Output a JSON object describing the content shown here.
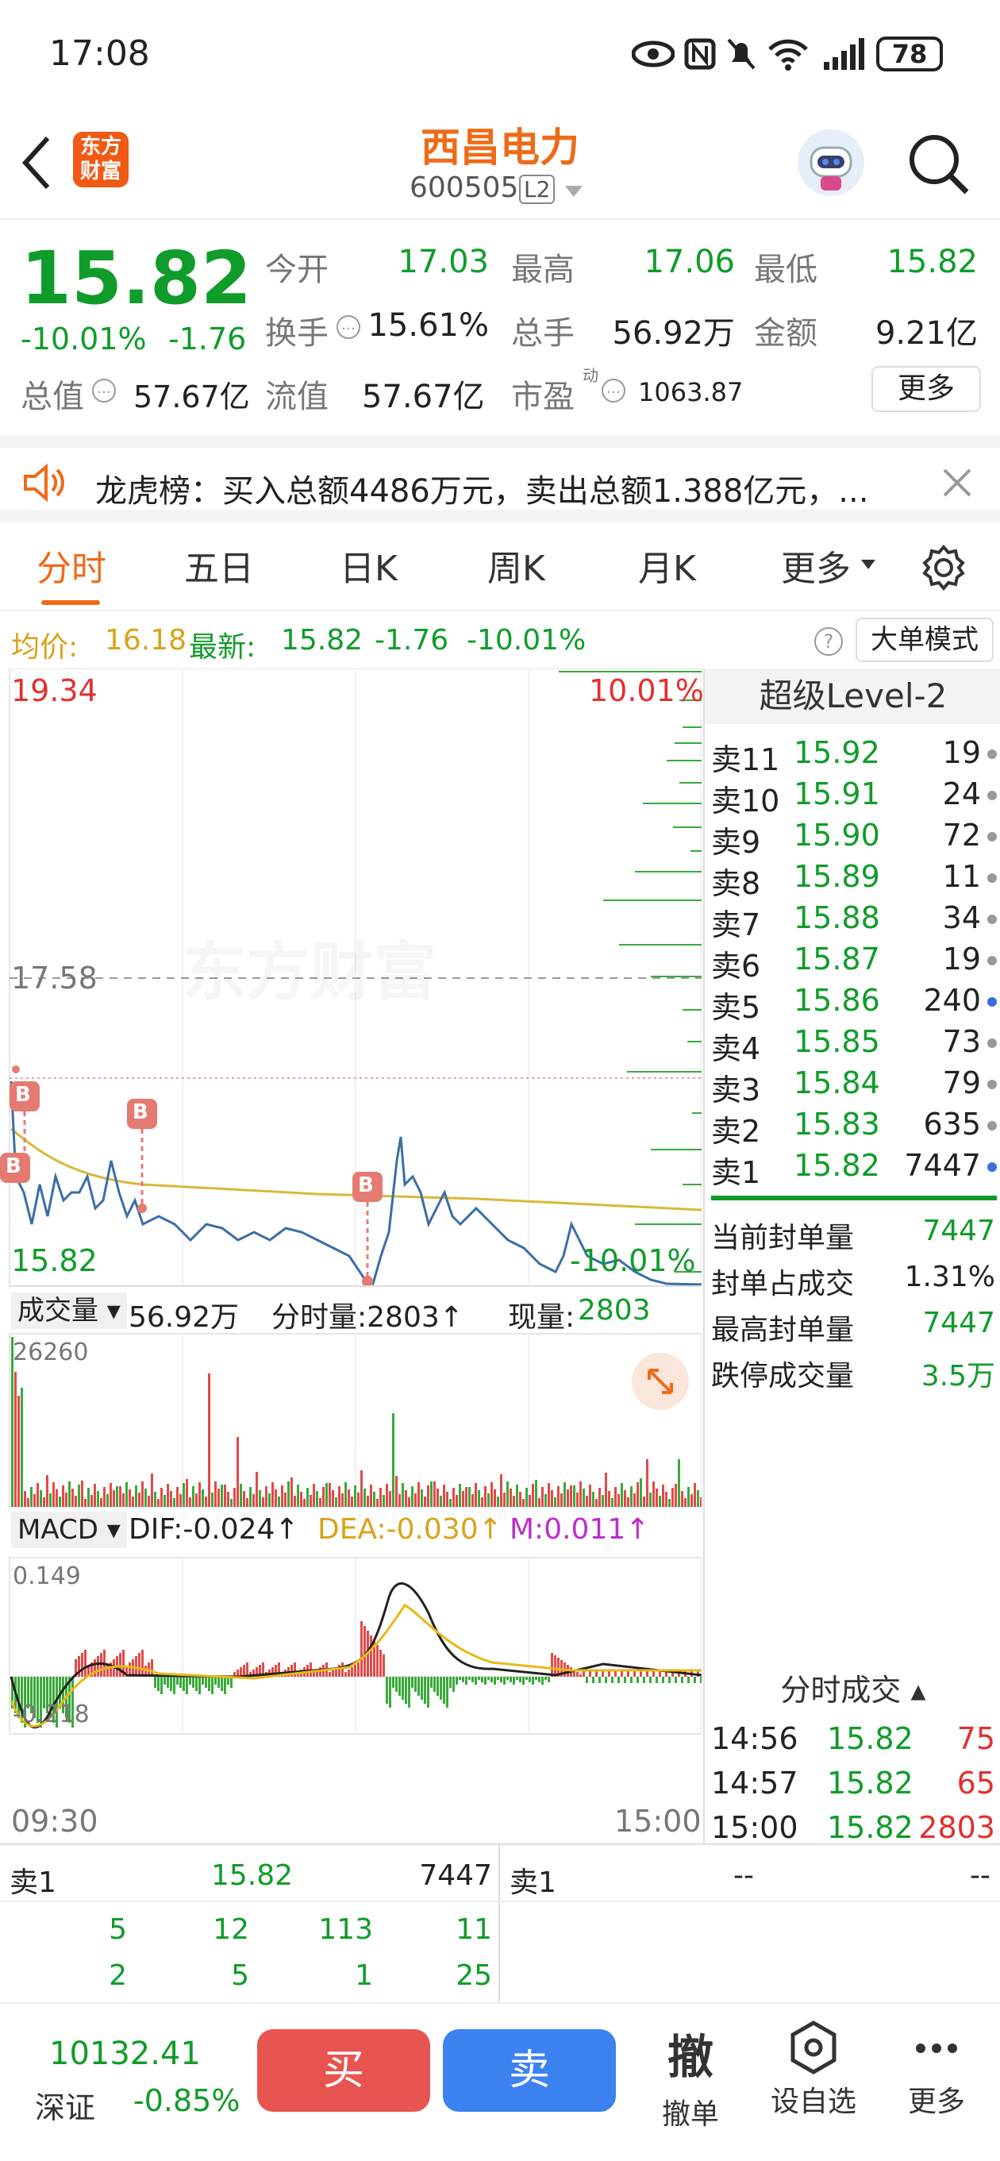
{
  "status": {
    "time": "17:08",
    "battery": "78"
  },
  "header": {
    "title": "西昌电力",
    "code": "600505",
    "level_badge": "L2",
    "logo_text_1": "东方",
    "logo_text_2": "财富"
  },
  "quote": {
    "price": "15.82",
    "change_pct": "-10.01%",
    "change": "-1.76",
    "fields": [
      {
        "label": "今开",
        "value": "17.03"
      },
      {
        "label": "最高",
        "value": "17.06"
      },
      {
        "label": "最低",
        "value": "15.82"
      },
      {
        "label": "换手",
        "value": "15.61%"
      },
      {
        "label": "总手",
        "value": "56.92万"
      },
      {
        "label": "金额",
        "value": "9.21亿"
      },
      {
        "label": "总值",
        "value": "57.67亿"
      },
      {
        "label": "流值",
        "value": "57.67亿"
      },
      {
        "label": "市盈",
        "value": "1063.87",
        "sup": "动"
      }
    ],
    "more": "更多"
  },
  "notice": {
    "text": "龙虎榜：买入总额4486万元，卖出总额1.388亿元，..."
  },
  "tabs": [
    "分时",
    "五日",
    "日K",
    "周K",
    "月K",
    "更多"
  ],
  "summary": {
    "avg_label": "均价:",
    "avg": "16.18",
    "latest_label": "最新:",
    "latest": "15.82",
    "chg": "-1.76",
    "pct": "-10.01%",
    "mode_btn": "大单模式"
  },
  "chart": {
    "top_price": "19.34",
    "top_pct": "10.01%",
    "mid_price": "17.58",
    "bottom_price": "15.82",
    "bottom_pct": "-10.01%",
    "watermark": "东方财富",
    "vol_label": "成交量",
    "vol_total": "56.92万",
    "tick_vol": "分时量:2803↑",
    "now_label": "现量:",
    "now_val": "2803",
    "vol_max": "26260",
    "macd_label": "MACD",
    "dif": "DIF:-0.024↑",
    "dea": "DEA:-0.030↑",
    "m": "M:0.011↑",
    "macd_max": "0.149",
    "macd_min": "-0.218",
    "time_start": "09:30",
    "time_end": "15:00",
    "trade_marker": "B"
  },
  "orderbook": {
    "title": "超级Level-2",
    "asks": [
      {
        "label": "卖11",
        "price": "15.92",
        "vol": "19"
      },
      {
        "label": "卖10",
        "price": "15.91",
        "vol": "24"
      },
      {
        "label": "卖9",
        "price": "15.90",
        "vol": "72"
      },
      {
        "label": "卖8",
        "price": "15.89",
        "vol": "11"
      },
      {
        "label": "卖7",
        "price": "15.88",
        "vol": "34"
      },
      {
        "label": "卖6",
        "price": "15.87",
        "vol": "19"
      },
      {
        "label": "卖5",
        "price": "15.86",
        "vol": "240"
      },
      {
        "label": "卖4",
        "price": "15.85",
        "vol": "73"
      },
      {
        "label": "卖3",
        "price": "15.84",
        "vol": "79"
      },
      {
        "label": "卖2",
        "price": "15.83",
        "vol": "635"
      },
      {
        "label": "卖1",
        "price": "15.82",
        "vol": "7447"
      }
    ],
    "stats": [
      {
        "label": "当前封单量",
        "value": "7447"
      },
      {
        "label": "封单占成交",
        "value": "1.31%"
      },
      {
        "label": "最高封单量",
        "value": "7447"
      },
      {
        "label": "跌停成交量",
        "value": "3.5万"
      }
    ],
    "trades_title": "分时成交",
    "trades": [
      {
        "time": "14:56",
        "price": "15.82",
        "vol": "75"
      },
      {
        "time": "14:57",
        "price": "15.82",
        "vol": "65"
      },
      {
        "time": "15:00",
        "price": "15.82",
        "vol": "2803"
      }
    ]
  },
  "bottom_table": {
    "left_label": "卖1",
    "left_price": "15.82",
    "left_vol": "7447",
    "right_label": "卖1",
    "right_price": "--",
    "right_vol": "--",
    "row1": [
      "5",
      "12",
      "113",
      "11"
    ],
    "row2": [
      "2",
      "5",
      "1",
      "25"
    ]
  },
  "bottombar": {
    "index_value": "10132.41",
    "index_name": "深证",
    "index_pct": "-0.85%",
    "buy": "买",
    "sell": "卖",
    "cancel_icon": "撤",
    "cancel": "撤单",
    "watch": "设自选",
    "more": "更多"
  }
}
